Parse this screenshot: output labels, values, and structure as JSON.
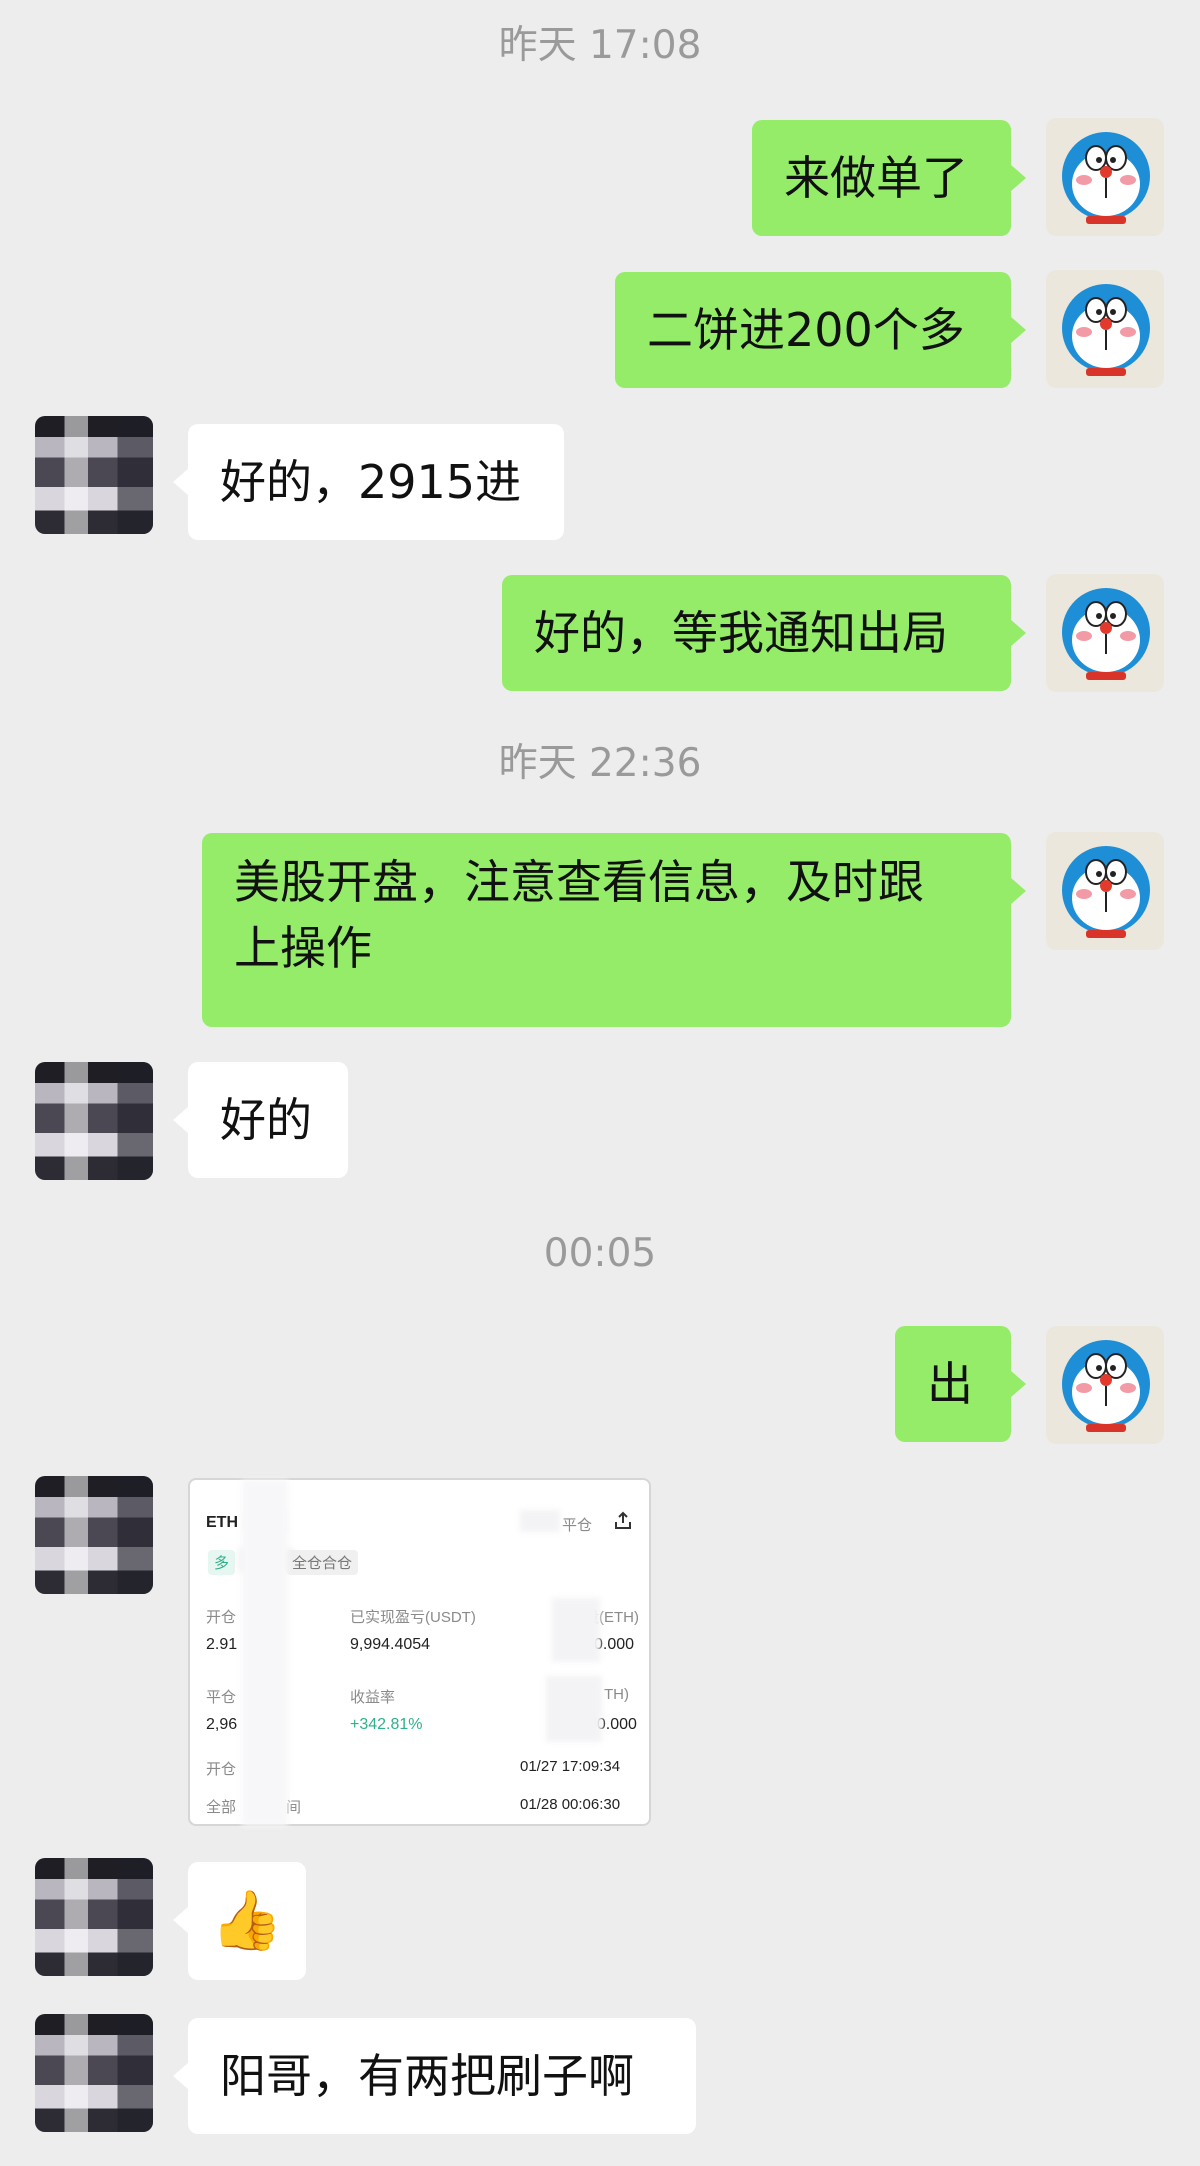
{
  "chat": {
    "messages": [
      {
        "type": "time",
        "text": "昨天 17:08"
      },
      {
        "type": "text",
        "from": "me",
        "text": "来做单了"
      },
      {
        "type": "text",
        "from": "me",
        "text": "二饼进200个多"
      },
      {
        "type": "text",
        "from": "them",
        "text": "好的，2915进"
      },
      {
        "type": "text",
        "from": "me",
        "text": "好的，等我通知出局"
      },
      {
        "type": "time",
        "text": "昨天 22:36"
      },
      {
        "type": "text",
        "from": "me",
        "text_line1": "美股开盘，注意查看信息，及时跟",
        "text_line2": "上操作"
      },
      {
        "type": "text",
        "from": "them",
        "text": "好的"
      },
      {
        "type": "time",
        "text": "00:05"
      },
      {
        "type": "text",
        "from": "me",
        "text": "出"
      },
      {
        "type": "image",
        "from": "them"
      },
      {
        "type": "emoji",
        "from": "them",
        "text": "👍"
      },
      {
        "type": "text",
        "from": "them",
        "text": "阳哥，有两把刷子啊"
      }
    ]
  },
  "trade_card": {
    "symbol": "ETH",
    "close_label": "平仓",
    "direction_tag": "多",
    "margin_tag": "全仓合仓",
    "open_label": "开仓",
    "open_value": "2.91",
    "realized_pnl_label": "已实现盈亏(USDT)",
    "realized_pnl_value": "9,994.4054",
    "qty_label": "量(ETH)",
    "qty_value": "0.000",
    "close_price_label": "平仓",
    "close_price_value": "2,96",
    "roi_label": "收益率",
    "roi_value": "+342.81%",
    "qty2_label": "TH)",
    "qty2_value": "00.000",
    "open_time_label": "开仓",
    "open_time_value": "01/27 17:09:34",
    "all_close_label": "全部",
    "all_close_label2": "间",
    "all_close_value": "01/28 00:06:30"
  },
  "colors": {
    "background": "#ededed",
    "my_bubble": "#95ec69",
    "their_bubble": "#ffffff",
    "positive": "#2fb08a"
  }
}
